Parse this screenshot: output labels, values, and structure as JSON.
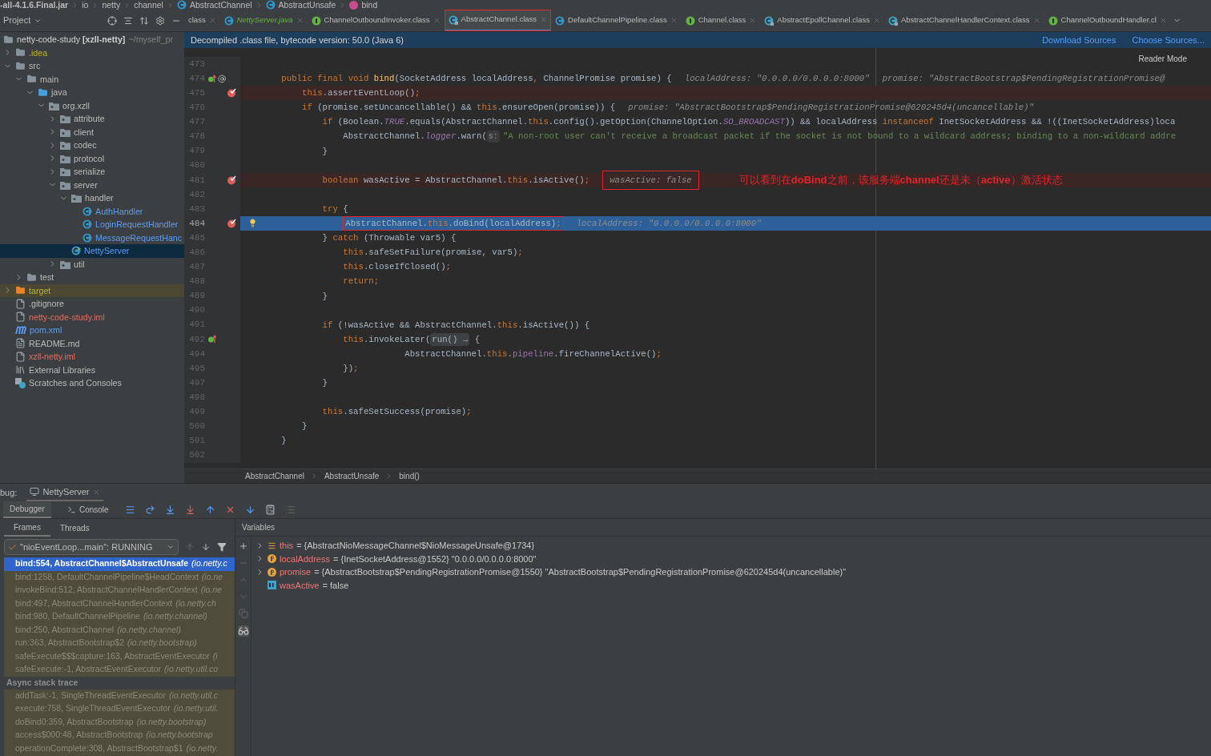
{
  "breadcrumb": [
    {
      "label": "-all-4.1.6.Final.jar",
      "kind": "plain"
    },
    {
      "label": "io",
      "kind": "plain"
    },
    {
      "label": "netty",
      "kind": "plain"
    },
    {
      "label": "channel",
      "kind": "plain"
    },
    {
      "label": "AbstractChannel",
      "kind": "class"
    },
    {
      "label": "AbstractUnsafe",
      "kind": "class"
    },
    {
      "label": "bind",
      "kind": "method"
    }
  ],
  "project_tool": {
    "title": "Project"
  },
  "editor_tabs": [
    {
      "label": "class",
      "kind": "plain",
      "selected": false,
      "marked": false
    },
    {
      "label": "NettyServer.java",
      "kind": "java",
      "selected": false,
      "marked": false
    },
    {
      "label": "ChannelOutboundInvoker.class",
      "kind": "interface",
      "selected": false,
      "marked": false
    },
    {
      "label": "AbstractChannel.class",
      "kind": "abstract",
      "selected": true,
      "marked": true
    },
    {
      "label": "DefaultChannelPipeline.class",
      "kind": "class",
      "selected": false,
      "marked": false
    },
    {
      "label": "Channel.class",
      "kind": "interface",
      "selected": false,
      "marked": false
    },
    {
      "label": "AbstractEpollChannel.class",
      "kind": "abstract",
      "selected": false,
      "marked": false
    },
    {
      "label": "AbstractChannelHandlerContext.class",
      "kind": "abstract",
      "selected": false,
      "marked": false
    },
    {
      "label": "ChannelOutboundHandler.cl",
      "kind": "interface",
      "selected": false,
      "marked": false
    }
  ],
  "project_root": {
    "label": "netty-code-study **[xzll-netty]**",
    "path": "~/myself_pr"
  },
  "tree": [
    {
      "label": ".idea",
      "kind": "folder",
      "color": "#bbb529",
      "expanded": false,
      "selected": false
    },
    {
      "label": "src",
      "kind": "folder",
      "expanded": true,
      "selected": false,
      "children": [
        {
          "label": "main",
          "kind": "folder",
          "expanded": true,
          "selected": false,
          "children": [
            {
              "label": "java",
              "kind": "source-folder",
              "expanded": true,
              "selected": false,
              "children": [
                {
                  "label": "org.xzll",
                  "kind": "package",
                  "expanded": true,
                  "selected": false,
                  "children": [
                    {
                      "label": "attribute",
                      "kind": "package",
                      "expanded": false,
                      "selected": false
                    },
                    {
                      "label": "client",
                      "kind": "package",
                      "expanded": false,
                      "selected": false
                    },
                    {
                      "label": "codec",
                      "kind": "package",
                      "expanded": false,
                      "selected": false
                    },
                    {
                      "label": "protocol",
                      "kind": "package",
                      "expanded": false,
                      "selected": false
                    },
                    {
                      "label": "serialize",
                      "kind": "package",
                      "expanded": false,
                      "selected": false
                    },
                    {
                      "label": "server",
                      "kind": "package",
                      "expanded": true,
                      "selected": false,
                      "children": [
                        {
                          "label": "handler",
                          "kind": "package",
                          "expanded": true,
                          "selected": false,
                          "children": [
                            {
                              "label": "AuthHandler",
                              "kind": "class",
                              "color": "#589df6",
                              "selected": false
                            },
                            {
                              "label": "LoginRequestHandler",
                              "kind": "class",
                              "color": "#589df6",
                              "selected": false
                            },
                            {
                              "label": "MessageRequestHanc",
                              "kind": "class",
                              "color": "#589df6",
                              "selected": false
                            }
                          ]
                        },
                        {
                          "label": "NettyServer",
                          "kind": "main-class",
                          "selected": true
                        }
                      ]
                    },
                    {
                      "label": "util",
                      "kind": "package",
                      "expanded": false,
                      "selected": false
                    }
                  ]
                }
              ]
            }
          ]
        },
        {
          "label": "test",
          "kind": "folder",
          "expanded": false,
          "selected": false
        }
      ]
    },
    {
      "label": "target",
      "kind": "excluded-folder",
      "color": "#bbb529",
      "expanded": false,
      "selected": false
    },
    {
      "label": ".gitignore",
      "kind": "ignore-file",
      "selected": false
    },
    {
      "label": "netty-code-study.iml",
      "kind": "module-file",
      "color": "#e06c60",
      "selected": false
    },
    {
      "label": "pom.xml",
      "kind": "maven-file",
      "color": "#589df6",
      "selected": false
    },
    {
      "label": "README.md",
      "kind": "markdown-file",
      "selected": false
    },
    {
      "label": "xzll-netty.iml",
      "kind": "module-file",
      "color": "#e06c60",
      "selected": false
    },
    {
      "label": "External Libraries",
      "kind": "libraries",
      "selected": false
    },
    {
      "label": "Scratches and Consoles",
      "kind": "scratches",
      "selected": false
    }
  ],
  "banner": {
    "text": "Decompiled .class file, bytecode version: 50.0 (Java 6)",
    "actions": [
      "Download Sources",
      "Choose Sources..."
    ]
  },
  "reader_mode": "Reader Mode",
  "code_lines": [
    {
      "number": "473",
      "breakpoint": false,
      "current": false
    },
    {
      "number": "474",
      "breakpoint": false,
      "current": false,
      "overrides": true,
      "annotated": true,
      "segments": [
        {
          "text": "        public final void ",
          "kind": "k"
        },
        {
          "text": "bind",
          "kind": "fn"
        },
        {
          "text": "(SocketAddress localAddress",
          "kind": "p"
        },
        {
          "text": ",",
          "kind": "k"
        },
        {
          "text": " ChannelPromise promise) {",
          "kind": "p"
        }
      ],
      "hints": [
        {
          "text": "localAddress: \"0.0.0.0/0.0.0.0:8000\"",
          "marked": false
        },
        {
          "text": "promise: \"AbstractBootstrap$PendingRegistrationPromise@",
          "marked": false
        }
      ]
    },
    {
      "number": "475",
      "breakpoint": true,
      "current": false,
      "segments": [
        {
          "text": "            this",
          "kind": "k"
        },
        {
          "text": ".assertEventLoop()",
          "kind": "p"
        },
        {
          "text": ";",
          "kind": "k"
        }
      ]
    },
    {
      "number": "476",
      "breakpoint": false,
      "current": false,
      "segments": [
        {
          "text": "            if",
          "kind": "k"
        },
        {
          "text": " (promise.setUncancellable() && ",
          "kind": "p"
        },
        {
          "text": "this",
          "kind": "k"
        },
        {
          "text": ".ensureOpen(promise)) {",
          "kind": "p"
        }
      ],
      "hints": [
        {
          "text": "promise: \"AbstractBootstrap$PendingRegistrationPromise@620245d4(uncancellable)\"",
          "marked": false
        }
      ]
    },
    {
      "number": "477",
      "breakpoint": false,
      "current": false,
      "segments": [
        {
          "text": "                if",
          "kind": "k"
        },
        {
          "text": " (Boolean.",
          "kind": "p"
        },
        {
          "text": "TRUE",
          "kind": "fi"
        },
        {
          "text": ".equals(AbstractChannel.",
          "kind": "p"
        },
        {
          "text": "this",
          "kind": "k"
        },
        {
          "text": ".config().getOption(ChannelOption.",
          "kind": "p"
        },
        {
          "text": "SO_BROADCAST",
          "kind": "fi"
        },
        {
          "text": ")) && localAddress ",
          "kind": "p"
        },
        {
          "text": "instanceof",
          "kind": "k"
        },
        {
          "text": " InetSocketAddress && !((InetSocketAddress)loca",
          "kind": "p"
        }
      ]
    },
    {
      "number": "478",
      "breakpoint": false,
      "current": false,
      "segments": [
        {
          "text": "                    AbstractChannel.",
          "kind": "p"
        },
        {
          "text": "logger",
          "kind": "fi"
        },
        {
          "text": ".warn(",
          "kind": "p"
        },
        {
          "text": "s:",
          "kind": "param"
        },
        {
          "text": "\"A non-root user can't receive a broadcast packet if the socket is not bound to a wildcard address; binding to a non-wildcard addre",
          "kind": "s"
        }
      ]
    },
    {
      "number": "479",
      "breakpoint": false,
      "current": false,
      "segments": [
        {
          "text": "                }",
          "kind": "p"
        }
      ]
    },
    {
      "number": "480",
      "breakpoint": false,
      "current": false
    },
    {
      "number": "481",
      "breakpoint": true,
      "current": false,
      "segments": [
        {
          "text": "                boolean",
          "kind": "k"
        },
        {
          "text": " wasActive = AbstractChannel.",
          "kind": "p"
        },
        {
          "text": "this",
          "kind": "k"
        },
        {
          "text": ".isActive()",
          "kind": "p"
        },
        {
          "text": ";",
          "kind": "k"
        }
      ],
      "hints": [
        {
          "text": "wasActive: false",
          "marked": true
        }
      ],
      "note": "可以看到在**doBind**之前，该服务端**channel**还是未（**active**）激活状态"
    },
    {
      "number": "482",
      "breakpoint": false,
      "current": false
    },
    {
      "number": "483",
      "breakpoint": false,
      "current": false,
      "segments": [
        {
          "text": "                try",
          "kind": "k"
        },
        {
          "text": " {",
          "kind": "p"
        }
      ]
    },
    {
      "number": "484",
      "breakpoint": true,
      "current": true,
      "intention": true,
      "segments": [
        {
          "text": "                    AbstractChannel.",
          "kind": "p",
          "boxed": true
        },
        {
          "text": "this",
          "kind": "k",
          "boxed": true
        },
        {
          "text": ".doBind(localAddress)",
          "kind": "p",
          "boxed": true
        },
        {
          "text": ";",
          "kind": "k",
          "boxed": true
        }
      ],
      "hints": [
        {
          "text": "localAddress: \"0.0.0.0/0.0.0.0:8000\"",
          "marked": false
        }
      ]
    },
    {
      "number": "485",
      "breakpoint": false,
      "current": false,
      "segments": [
        {
          "text": "                } ",
          "kind": "p"
        },
        {
          "text": "catch",
          "kind": "k"
        },
        {
          "text": " (Throwable var5) {",
          "kind": "p"
        }
      ]
    },
    {
      "number": "486",
      "breakpoint": false,
      "current": false,
      "segments": [
        {
          "text": "                    this",
          "kind": "k"
        },
        {
          "text": ".safeSetFailure(promise, var5)",
          "kind": "p"
        },
        {
          "text": ";",
          "kind": "k"
        }
      ]
    },
    {
      "number": "487",
      "breakpoint": false,
      "current": false,
      "segments": [
        {
          "text": "                    this",
          "kind": "k"
        },
        {
          "text": ".closeIfClosed()",
          "kind": "p"
        },
        {
          "text": ";",
          "kind": "k"
        }
      ]
    },
    {
      "number": "488",
      "breakpoint": false,
      "current": false,
      "segments": [
        {
          "text": "                    return;",
          "kind": "k"
        }
      ]
    },
    {
      "number": "489",
      "breakpoint": false,
      "current": false,
      "segments": [
        {
          "text": "                }",
          "kind": "p"
        }
      ]
    },
    {
      "number": "490",
      "breakpoint": false,
      "current": false
    },
    {
      "number": "491",
      "breakpoint": false,
      "current": false,
      "segments": [
        {
          "text": "                if",
          "kind": "k"
        },
        {
          "text": " (!wasActive && AbstractChannel.",
          "kind": "p"
        },
        {
          "text": "this",
          "kind": "k"
        },
        {
          "text": ".isActive()) {",
          "kind": "p"
        }
      ]
    },
    {
      "number": "492",
      "breakpoint": false,
      "current": false,
      "overrides": true,
      "segments": [
        {
          "text": "                    this",
          "kind": "k"
        },
        {
          "text": ".invokeLater(",
          "kind": "p"
        },
        {
          "text": "run() →",
          "kind": "fold"
        },
        {
          "text": " {",
          "kind": "p"
        }
      ]
    },
    {
      "number": "494",
      "breakpoint": false,
      "current": false,
      "segments": [
        {
          "text": "                                AbstractChannel.",
          "kind": "p"
        },
        {
          "text": "this",
          "kind": "k"
        },
        {
          "text": ".",
          "kind": "p"
        },
        {
          "text": "pipeline",
          "kind": "f"
        },
        {
          "text": ".fireChannelActive()",
          "kind": "p"
        },
        {
          "text": ";",
          "kind": "k"
        }
      ]
    },
    {
      "number": "495",
      "breakpoint": false,
      "current": false,
      "segments": [
        {
          "text": "                    })",
          "kind": "p"
        },
        {
          "text": ";",
          "kind": "k"
        }
      ]
    },
    {
      "number": "497",
      "breakpoint": false,
      "current": false,
      "segments": [
        {
          "text": "                }",
          "kind": "p"
        }
      ]
    },
    {
      "number": "498",
      "breakpoint": false,
      "current": false
    },
    {
      "number": "499",
      "breakpoint": false,
      "current": false,
      "segments": [
        {
          "text": "                this",
          "kind": "k"
        },
        {
          "text": ".safeSetSuccess(promise)",
          "kind": "p"
        },
        {
          "text": ";",
          "kind": "k"
        }
      ]
    },
    {
      "number": "500",
      "breakpoint": false,
      "current": false,
      "segments": [
        {
          "text": "            }",
          "kind": "p"
        }
      ]
    },
    {
      "number": "501",
      "breakpoint": false,
      "current": false,
      "segments": [
        {
          "text": "        }",
          "kind": "p"
        }
      ]
    },
    {
      "number": "502",
      "breakpoint": false,
      "current": false
    }
  ],
  "editor_breadcrumb": [
    "AbstractChannel",
    "AbstractUnsafe",
    "bind()"
  ],
  "debug": {
    "title": "bug:",
    "session": "NettyServer",
    "tabs": [
      {
        "label": "Debugger",
        "selected": true
      },
      {
        "label": "Console",
        "selected": false
      }
    ],
    "subtabs": [
      {
        "label": "Frames",
        "selected": true
      },
      {
        "label": "Threads",
        "selected": false
      }
    ],
    "variables_title": "Variables",
    "thread": "\"nioEventLoop...main\": RUNNING",
    "frames": [
      {
        "method": "bind:554, AbstractChannel$AbstractUnsafe",
        "package": "(io.netty.c",
        "selected": true
      },
      {
        "method": "bind:1258, DefaultChannelPipeline$HeadContext",
        "package": "(io.ne",
        "selected": false
      },
      {
        "method": "invokeBind:512, AbstractChannelHandlerContext",
        "package": "(io.ne",
        "selected": false
      },
      {
        "method": "bind:497, AbstractChannelHandlerContext",
        "package": "(io.netty.ch",
        "selected": false
      },
      {
        "method": "bind:980, DefaultChannelPipeline",
        "package": "(io.netty.channel)",
        "selected": false
      },
      {
        "method": "bind:250, AbstractChannel",
        "package": "(io.netty.channel)",
        "selected": false
      },
      {
        "method": "run:363, AbstractBootstrap$2",
        "package": "(io.netty.bootstrap)",
        "selected": false
      },
      {
        "method": "safeExecute$$$capture:163, AbstractEventExecutor",
        "package": "(i",
        "selected": false
      },
      {
        "method": "safeExecute:-1, AbstractEventExecutor",
        "package": "(io.netty.util.co",
        "selected": false
      }
    ],
    "async_title": "Async stack trace",
    "async_frames": [
      {
        "method": "addTask:-1, SingleThreadEventExecutor",
        "package": "(io.netty.util.c",
        "selected": false
      },
      {
        "method": "execute:758, SingleThreadEventExecutor",
        "package": "(io.netty.util.",
        "selected": false
      },
      {
        "method": "doBind0:359, AbstractBootstrap",
        "package": "(io.netty.bootstrap)",
        "selected": false
      },
      {
        "method": "access$000:48, AbstractBootstrap",
        "package": "(io.netty.bootstrap",
        "selected": false
      },
      {
        "method": "operationComplete:308, AbstractBootstrap$1",
        "package": "(io.netty.",
        "selected": false
      }
    ],
    "variables": [
      {
        "name": "this",
        "kind": "object",
        "expanded": false,
        "value": "= {AbstractNioMessageChannel$NioMessageUnsafe@1734}"
      },
      {
        "name": "localAddress",
        "kind": "param",
        "expanded": false,
        "value": "= {InetSocketAddress@1552} \"0.0.0.0/0.0.0.0:8000\""
      },
      {
        "name": "promise",
        "kind": "param",
        "expanded": false,
        "value": "= {AbstractBootstrap$PendingRegistrationPromise@1550} \"AbstractBootstrap$PendingRegistrationPromise@620245d4(uncancellable)\""
      },
      {
        "name": "wasActive",
        "kind": "primitive",
        "value": "= false"
      }
    ]
  }
}
